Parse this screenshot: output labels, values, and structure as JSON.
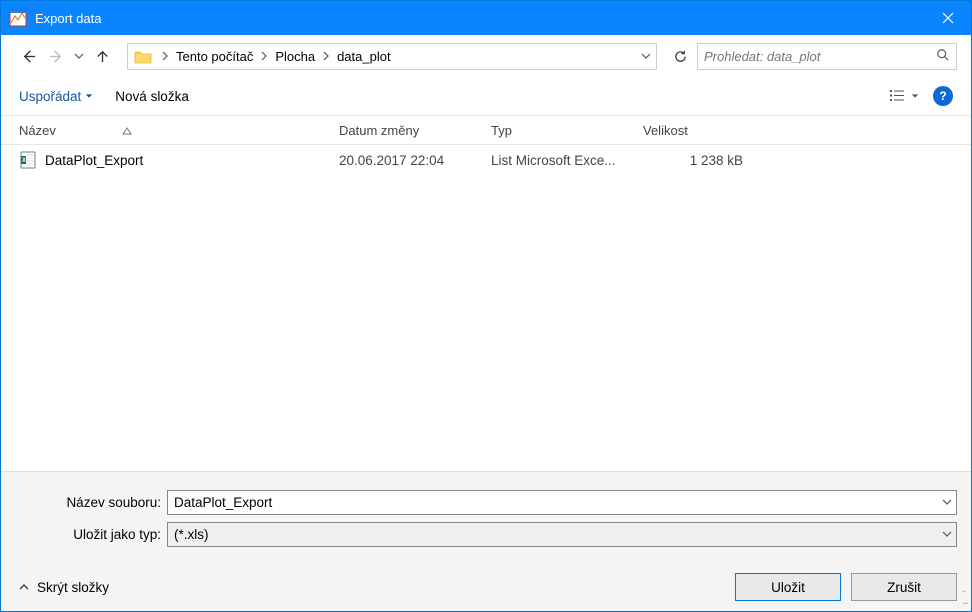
{
  "title": "Export data",
  "breadcrumbs": [
    "Tento počítač",
    "Plocha",
    "data_plot"
  ],
  "search_placeholder": "Prohledat: data_plot",
  "toolbar": {
    "organize": "Uspořádat",
    "new_folder": "Nová složka"
  },
  "columns": {
    "name": "Název",
    "date": "Datum změny",
    "type": "Typ",
    "size": "Velikost"
  },
  "files": [
    {
      "name": "DataPlot_Export",
      "date": "20.06.2017 22:04",
      "type": "List Microsoft Exce...",
      "size": "1 238 kB"
    }
  ],
  "form": {
    "filename_label": "Název souboru:",
    "filename_value": "DataPlot_Export",
    "type_label": "Uložit jako typ:",
    "type_value": "(*.xls)"
  },
  "actions": {
    "hide_folders": "Skrýt složky",
    "save": "Uložit",
    "cancel": "Zrušit"
  }
}
